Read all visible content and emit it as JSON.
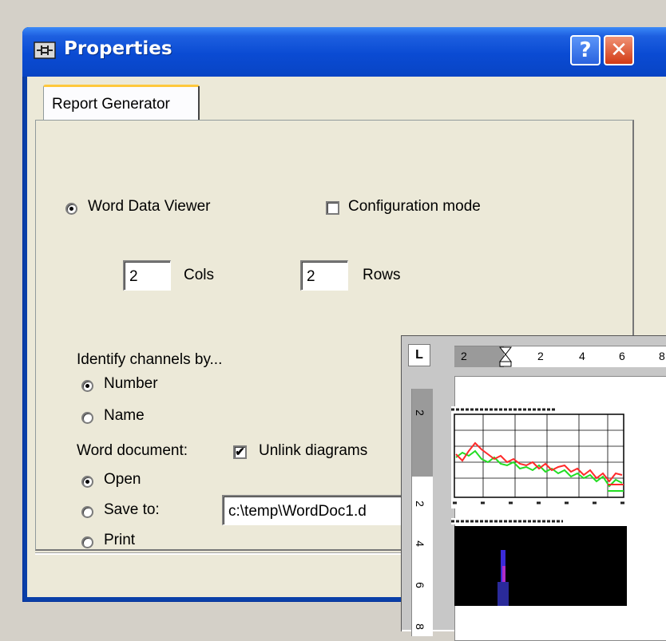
{
  "window": {
    "title": "Properties",
    "help_label": "?",
    "close_label": "✕"
  },
  "tabs": [
    {
      "label": "Report Generator"
    }
  ],
  "options": {
    "viewer_label": "Word Data Viewer",
    "config_label": "Configuration mode",
    "cols_value": "2",
    "cols_label": "Cols",
    "rows_value": "2",
    "rows_label": "Rows",
    "identify_label": "Identify channels by...",
    "number_label": "Number",
    "name_label": "Name",
    "worddoc_label": "Word document:",
    "unlink_label": "Unlink diagrams",
    "open_label": "Open",
    "save_label": "Save to:",
    "save_path": "c:\\temp\\WordDoc1.d",
    "print_label": "Print"
  },
  "word_preview": {
    "corner": "L",
    "hruler_numbers": [
      "2",
      "2",
      "4",
      "6",
      "8"
    ],
    "vruler_numbers": [
      "2",
      "2",
      "4",
      "6",
      "8"
    ]
  },
  "colors": {
    "titlebar": "#0a4bd3",
    "face": "#ece9d8",
    "chart_red": "#ff2a2a",
    "chart_green": "#22dd22"
  }
}
